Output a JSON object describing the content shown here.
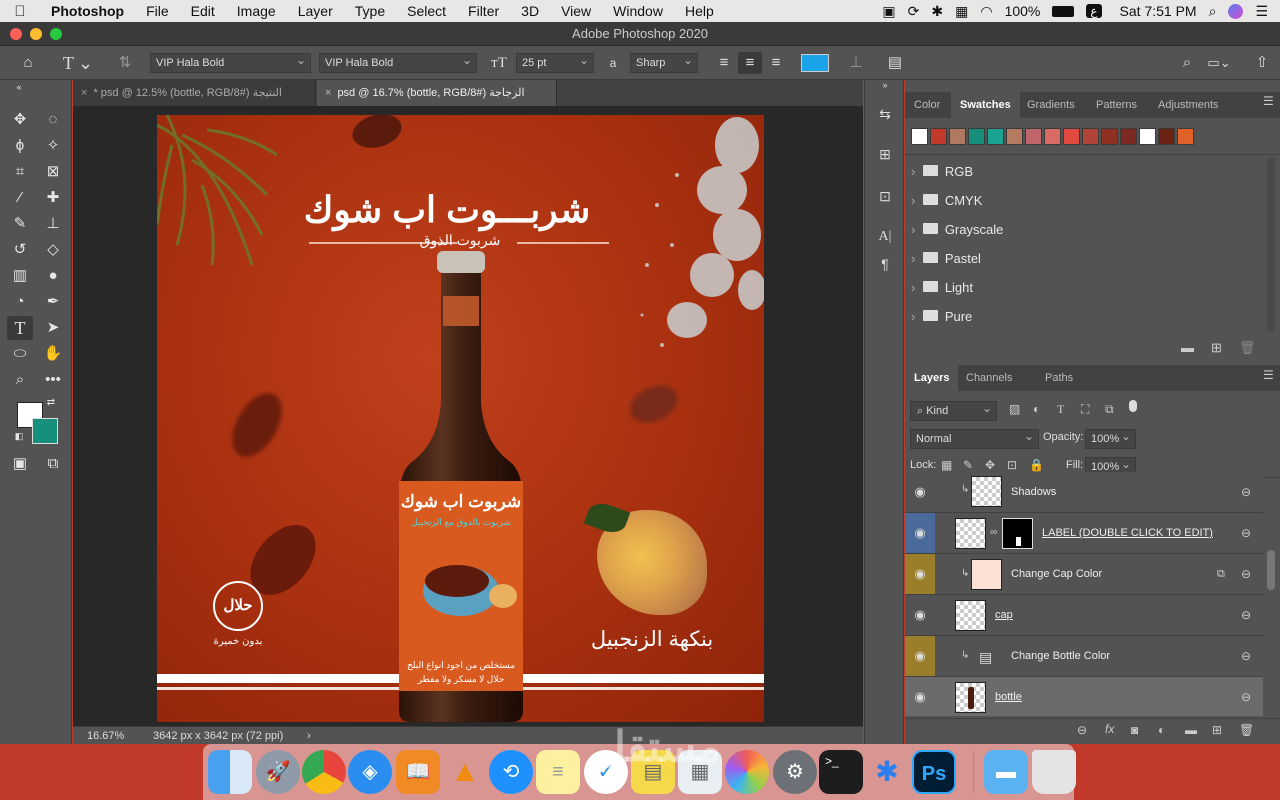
{
  "menubar": {
    "app": "Photoshop",
    "items": [
      "File",
      "Edit",
      "Image",
      "Layer",
      "Type",
      "Select",
      "Filter",
      "3D",
      "View",
      "Window",
      "Help"
    ],
    "battery": "100%",
    "keyboard": "ع",
    "clock": "Sat 7:51 PM"
  },
  "window": {
    "title": "Adobe Photoshop 2020"
  },
  "options": {
    "font_family": "VIP Hala Bold",
    "font_style": "VIP Hala Bold",
    "font_size": "25 pt",
    "aa_label": "a",
    "antialias": "Sharp",
    "text_color": "#1aa3e8"
  },
  "tabs": [
    {
      "label": "* psd @ 12.5% (bottle, RGB/8#) النتيجة"
    },
    {
      "label": "psd @ 16.7% (bottle, RGB/8#) الزجاجة"
    }
  ],
  "artwork": {
    "headline": "شربـــوت اب شوك",
    "subheadline": "شربوت الذوق",
    "label_title": "شربوت اب شوك",
    "label_sub": "شربوت بالذوق مع الزنجبيل",
    "label_desc_1": "مستخلص من اجود انواع البلح",
    "label_desc_2": "حلال لا مسكر ولا مفطر",
    "halal": "حلال",
    "halal_sub": "بدون خميرة",
    "ginger_flavor": "بنكهة الزنجبيل"
  },
  "status": {
    "zoom": "16.67%",
    "doc_info": "3642 px x 3642 px (72 ppi)"
  },
  "color_panel": {
    "tabs": [
      "Color",
      "Swatches",
      "Gradients",
      "Patterns",
      "Adjustments"
    ],
    "active_tab": "Swatches",
    "swatches": [
      "#ffffff",
      "#c0392b",
      "#b07a62",
      "#168f7d",
      "#1aa390",
      "#b57a62",
      "#c0656a",
      "#d96b62",
      "#e04a3f",
      "#b04537",
      "#8e2f22",
      "#7a2a20",
      "#ffffff",
      "#6b2215",
      "#e0622a"
    ],
    "folders": [
      "RGB",
      "CMYK",
      "Grayscale",
      "Pastel",
      "Light",
      "Pure"
    ]
  },
  "layers_panel": {
    "tabs": [
      "Layers",
      "Channels",
      "Paths"
    ],
    "active_tab": "Layers",
    "filter": "Kind",
    "blend_mode": "Normal",
    "opacity_label": "Opacity:",
    "opacity": "100%",
    "lock_label": "Lock:",
    "fill_label": "Fill:",
    "fill": "100%",
    "layers": [
      {
        "name": "Shadows",
        "color": ""
      },
      {
        "name": "LABEL (DOUBLE CLICK TO EDIT)",
        "color": "#4a6b99"
      },
      {
        "name": "Change Cap Color",
        "color": "#9a7e2a"
      },
      {
        "name": "cap",
        "color": ""
      },
      {
        "name": "Change Bottle Color",
        "color": "#9a7e2a"
      },
      {
        "name": "bottle",
        "color": ""
      }
    ]
  },
  "dock": {
    "apps": [
      "Finder",
      "Launchpad",
      "Chrome",
      "Safari",
      "Books",
      "VLC",
      "SHAREit",
      "Notes",
      "Reminders",
      "Stickies",
      "Preview",
      "Photos",
      "System Preferences",
      "Terminal",
      "Bluetooth",
      "Photoshop",
      "Downloads",
      "Trash"
    ]
  },
  "watermark": "مستقل"
}
